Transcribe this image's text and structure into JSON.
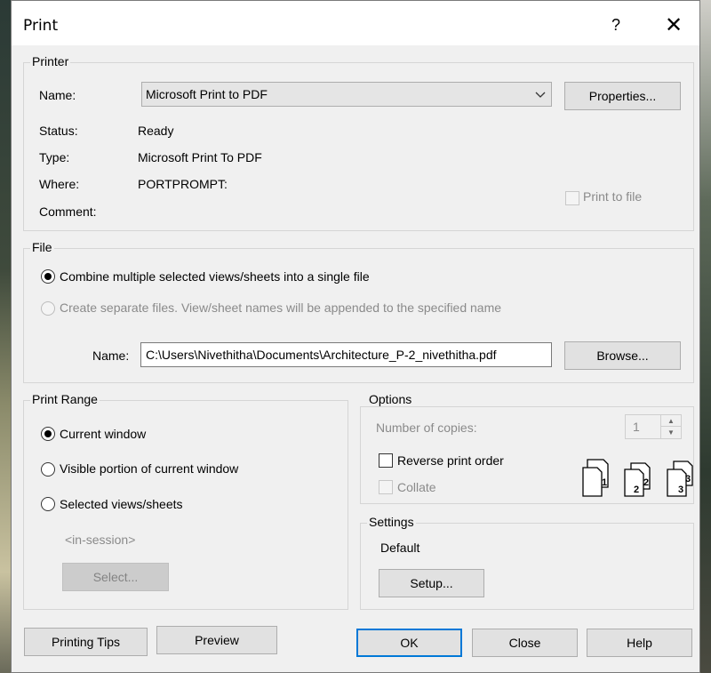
{
  "window": {
    "title": "Print",
    "help": "?",
    "close": "✕"
  },
  "printer": {
    "legend": "Printer",
    "name_label": "Name:",
    "name_value": "Microsoft Print to PDF",
    "properties_button": "Properties...",
    "status_label": "Status:",
    "status_value": "Ready",
    "type_label": "Type:",
    "type_value": "Microsoft Print To PDF",
    "where_label": "Where:",
    "where_value": "PORTPROMPT:",
    "comment_label": "Comment:",
    "print_to_file": "Print to file"
  },
  "file": {
    "legend": "File",
    "combine_option": "Combine multiple selected views/sheets into a single file",
    "separate_option": "Create separate files. View/sheet names will be appended to the specified name",
    "name_label": "Name:",
    "name_value": "C:\\Users\\Nivethitha\\Documents\\Architecture_P-2_nivethitha.pdf",
    "browse_button": "Browse..."
  },
  "print_range": {
    "legend": "Print Range",
    "current_window": "Current window",
    "visible_portion": "Visible portion of current window",
    "selected_views": "Selected views/sheets",
    "in_session": "<in-session>",
    "select_button": "Select..."
  },
  "options": {
    "legend": "Options",
    "copies_label": "Number of copies:",
    "copies_value": "1",
    "reverse_order": "Reverse print order",
    "collate": "Collate",
    "collate_pages": [
      "1",
      "2",
      "3"
    ]
  },
  "settings": {
    "legend": "Settings",
    "value": "Default",
    "setup_button": "Setup..."
  },
  "footer": {
    "printing_tips": "Printing Tips",
    "preview": "Preview",
    "ok": "OK",
    "close": "Close",
    "help": "Help"
  },
  "colors": {
    "accent": "#0078d7",
    "dialog_bg": "#f0f0f0",
    "disabled_text": "#8a8a8a"
  }
}
